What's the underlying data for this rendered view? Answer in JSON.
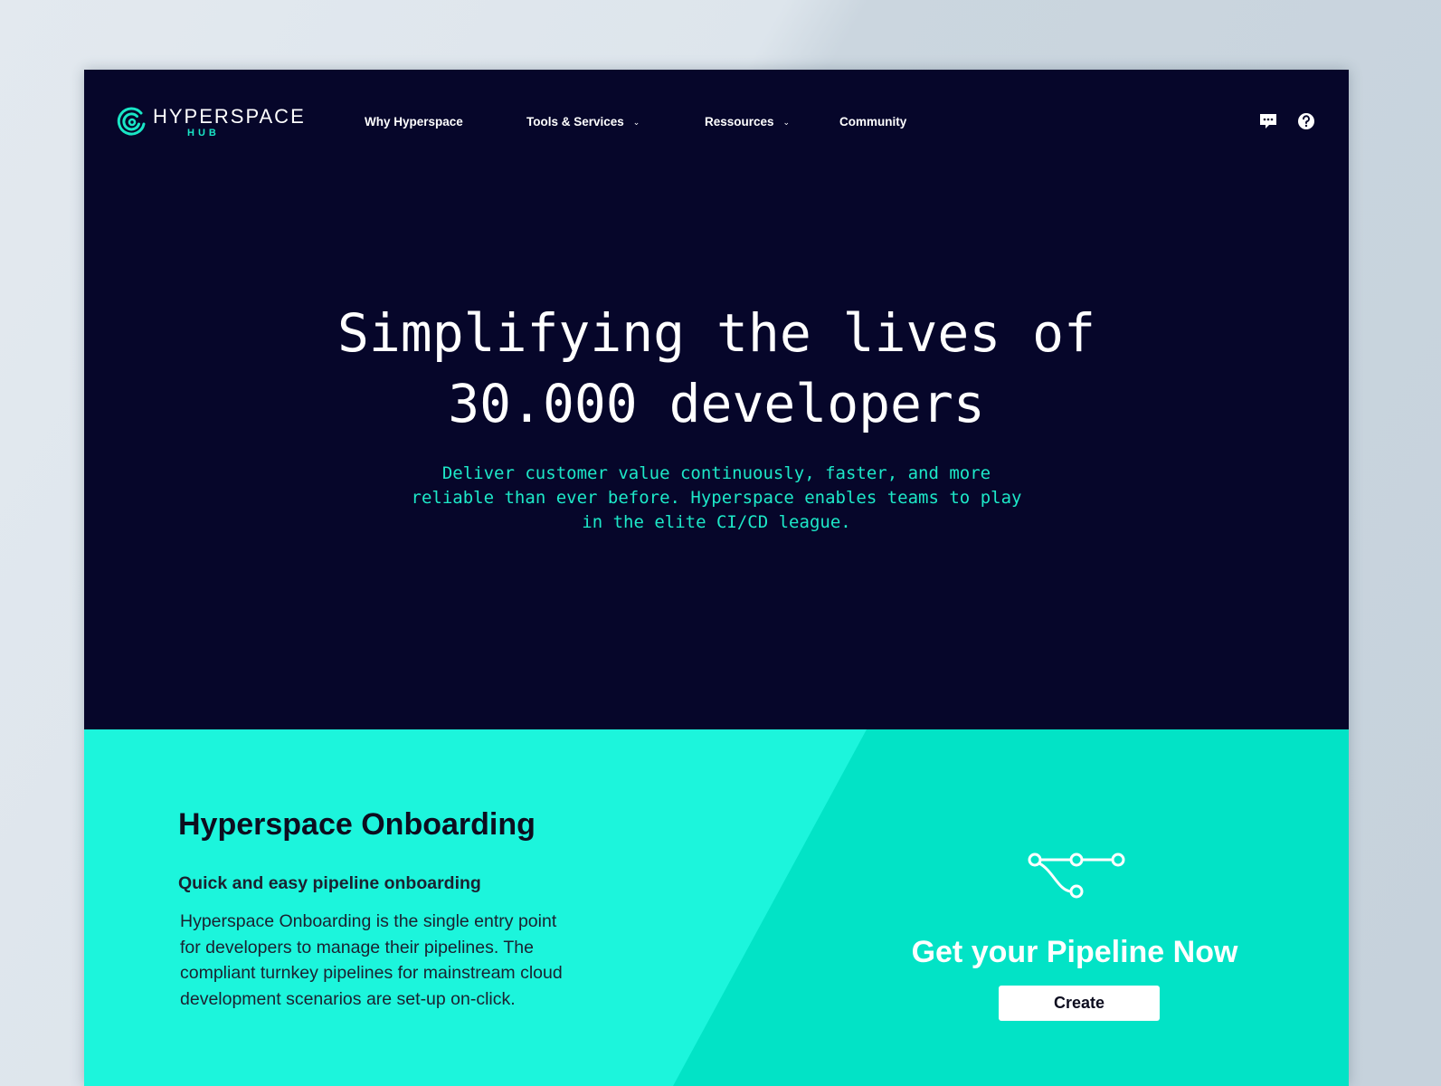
{
  "brand": {
    "name": "HYPERSPACE",
    "sub": "HUB",
    "accent_color": "#19e6c6",
    "dark_color": "#06062a"
  },
  "nav": {
    "items": [
      {
        "label": "Why Hyperspace",
        "dropdown": false
      },
      {
        "label": "Tools & Services",
        "dropdown": true
      },
      {
        "label": "Ressources",
        "dropdown": true
      },
      {
        "label": "Community",
        "dropdown": false
      }
    ],
    "actions": [
      "chat-icon",
      "help-icon"
    ]
  },
  "hero": {
    "title_line1": "Simplifying the lives of",
    "title_line2": "30.000 developers",
    "subtitle": "Deliver customer value continuously, faster, and more reliable than ever before. Hyperspace enables teams to play in the elite CI/CD league."
  },
  "onboarding": {
    "title": "Hyperspace Onboarding",
    "subtitle": "Quick and easy pipeline onboarding",
    "body": "Hyperspace Onboarding is the single entry point for developers to manage their pipelines. The compliant turnkey pipelines for mainstream cloud development scenarios are set-up on-click.",
    "cta_icon": "pipeline-icon",
    "cta_title": "Get your Pipeline Now",
    "cta_button": "Create",
    "bg_light": "#1cf5dc",
    "bg_dark": "#02e3c6"
  }
}
